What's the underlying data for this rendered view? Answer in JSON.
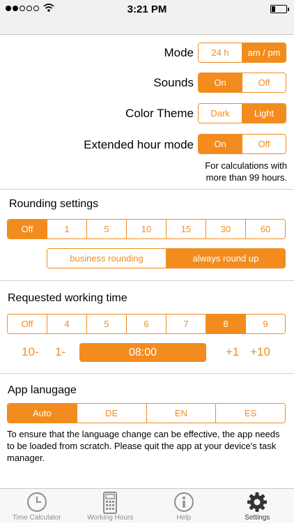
{
  "status": {
    "time": "3:21 PM"
  },
  "settings": {
    "mode": {
      "label": "Mode",
      "options": [
        "24 h",
        "am / pm"
      ],
      "selected": 1
    },
    "sounds": {
      "label": "Sounds",
      "options": [
        "On",
        "Off"
      ],
      "selected": 0
    },
    "theme": {
      "label": "Color Theme",
      "options": [
        "Dark",
        "Light"
      ],
      "selected": 1
    },
    "extended": {
      "label": "Extended hour mode",
      "options": [
        "On",
        "Off"
      ],
      "selected": 0,
      "note_line1": "For calculations with",
      "note_line2": "more than 99 hours."
    }
  },
  "rounding": {
    "title": "Rounding settings",
    "options": [
      "Off",
      "1",
      "5",
      "10",
      "15",
      "30",
      "60"
    ],
    "selected": 0,
    "method_options": [
      "business rounding",
      "always round up"
    ],
    "method_selected": 1
  },
  "working_time": {
    "title": "Requested working time",
    "options": [
      "Off",
      "4",
      "5",
      "6",
      "7",
      "8",
      "9"
    ],
    "selected": 5,
    "minus10": "10-",
    "minus1": "1-",
    "value": "08:00",
    "plus1": "+1",
    "plus10": "+10"
  },
  "language": {
    "title": "App lanugage",
    "options": [
      "Auto",
      "DE",
      "EN",
      "ES"
    ],
    "selected": 0,
    "note_line1": "To ensure that the language change can be effective, the app needs",
    "note_line2": "to be loaded from scratch. Please quit the app at your device's task",
    "note_line3": "manager."
  },
  "tabs": [
    {
      "label": "Time Calculator",
      "icon": "clock-icon"
    },
    {
      "label": "Working Hours",
      "icon": "calculator-icon"
    },
    {
      "label": "Help",
      "icon": "info-icon"
    },
    {
      "label": "Settings",
      "icon": "gear-icon"
    }
  ],
  "colors": {
    "accent": "#f28c1e"
  }
}
